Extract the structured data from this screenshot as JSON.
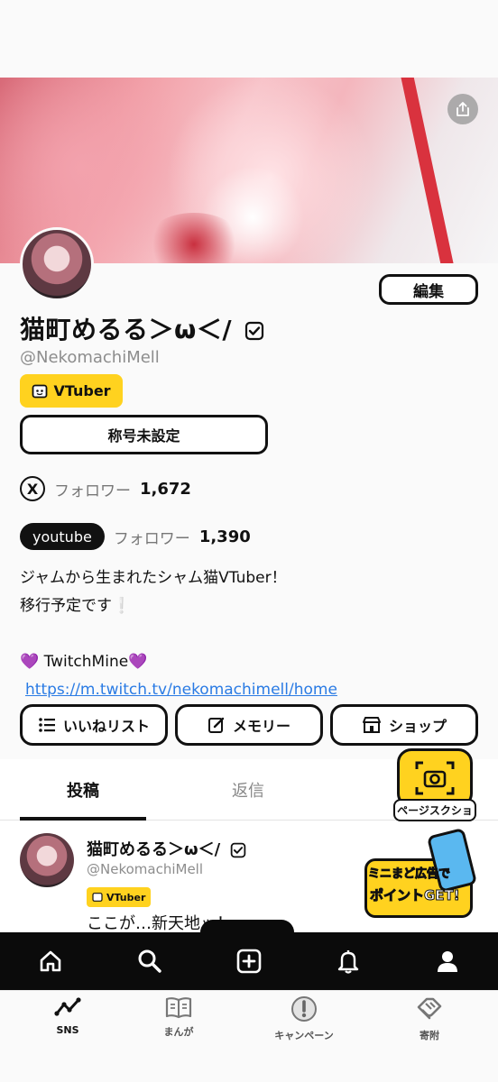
{
  "profile": {
    "display_name": "猫町めるる＞ω＜/",
    "handle": "@NekomachiMell",
    "badge": "VTuber",
    "edit_label": "編集",
    "title_label": "称号未設定"
  },
  "followers": [
    {
      "service": "X",
      "label": "フォロワー",
      "count": "1,672"
    },
    {
      "service": "youtube",
      "label": "フォロワー",
      "count": "1,390"
    }
  ],
  "bio": {
    "line1": "ジャムから生まれたシャム猫VTuber！",
    "line2": "移行予定です",
    "line3": "💜 TwitchMine💜",
    "link": "https://m.twitch.tv/nekomachimell/home"
  },
  "actions": {
    "likes_label": "いいねリスト",
    "memory_label": "メモリー",
    "shop_label": "ショップ"
  },
  "tabs": {
    "posts": "投稿",
    "replies": "返信"
  },
  "post": {
    "name": "猫町めるる＞ω＜/",
    "handle": "@NekomachiMell",
    "badge": "VTuber",
    "text": "ここが…新天地ッ！"
  },
  "widgets": {
    "screenshot_label": "ページスクショ",
    "ad_line1": "ミニまど広告で",
    "ad_line2": "ポイントGET!"
  },
  "tabbar": {
    "sns": "SNS",
    "manga": "まんが",
    "campaign": "キャンペーン",
    "donation": "寄附"
  },
  "colors": {
    "accent_yellow": "#ffd21f",
    "link_blue": "#2a7be4",
    "nav_black": "#0b0b0b"
  }
}
